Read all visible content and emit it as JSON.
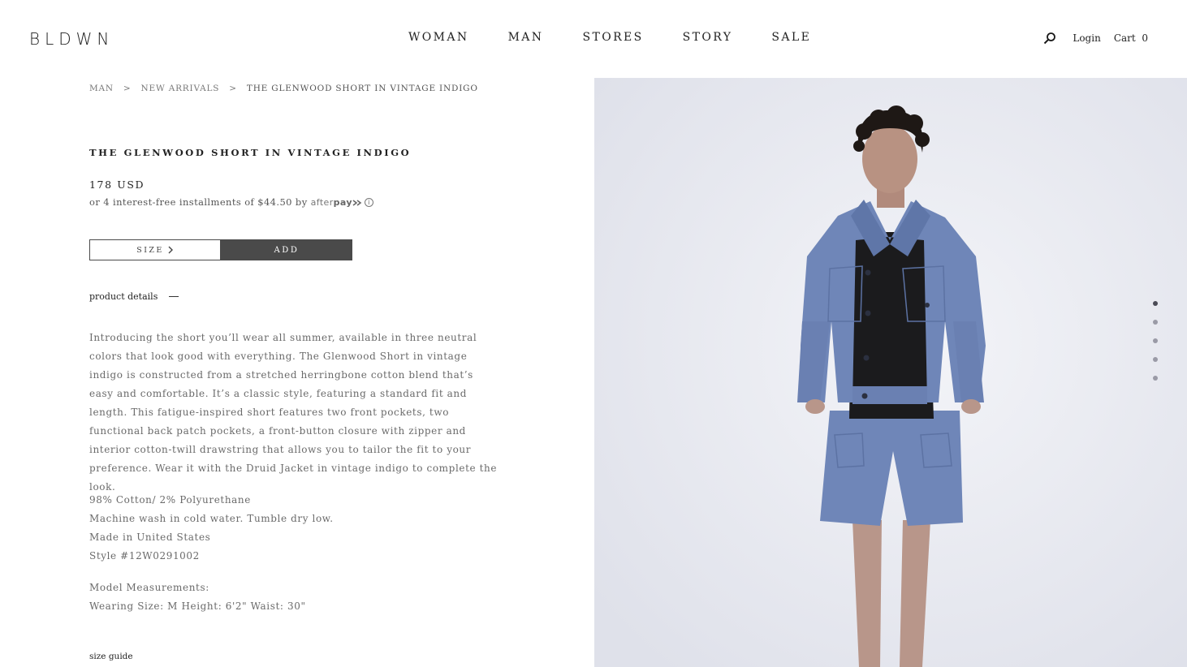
{
  "header": {
    "logo": "BLDWN",
    "nav": [
      "WOMAN",
      "MAN",
      "STORES",
      "STORY",
      "SALE"
    ],
    "login": "Login",
    "cart_label": "Cart",
    "cart_count": "0"
  },
  "breadcrumb": {
    "items": [
      "MAN",
      "NEW ARRIVALS",
      "THE GLENWOOD SHORT IN VINTAGE INDIGO"
    ],
    "separator": ">"
  },
  "product": {
    "title": "THE GLENWOOD SHORT IN VINTAGE INDIGO",
    "price": "178 USD",
    "installments": "or 4 interest-free installments of $44.50 by",
    "afterpay_brand_light": "after",
    "afterpay_brand_bold": "pay",
    "size_label": "SIZE",
    "add_label": "ADD",
    "details_label": "product details",
    "description": "Introducing the short you’ll wear all summer, available in three neutral colors that look good with everything. The Glenwood Short in vintage indigo is constructed from a stretched herringbone cotton blend that’s easy and comfortable. It’s a classic style, featuring a standard fit and length. This fatigue-inspired short features two front pockets, two functional back patch pockets, a front-button closure with zipper and interior cotton-twill drawstring that allows you to tailor the fit to your preference. Wear it with the Druid Jacket in vintage indigo to complete the look.",
    "specs": [
      "98% Cotton/ 2% Polyurethane",
      "Machine wash in cold water. Tumble dry low.",
      "Made in United States",
      "Style #12W0291002"
    ],
    "model_label": "Model Measurements:",
    "model_sizes": "Wearing Size: M Height: 6'2\" Waist: 30\"",
    "size_guide": "size guide"
  },
  "gallery": {
    "image_count": 5,
    "active_index": 0
  },
  "colors": {
    "text": "#2a2a2a",
    "muted": "#6a6a6a",
    "button_dark": "#4a4a4a",
    "photo_bg": "#e9eaf0",
    "denim": "#6f86b8"
  }
}
